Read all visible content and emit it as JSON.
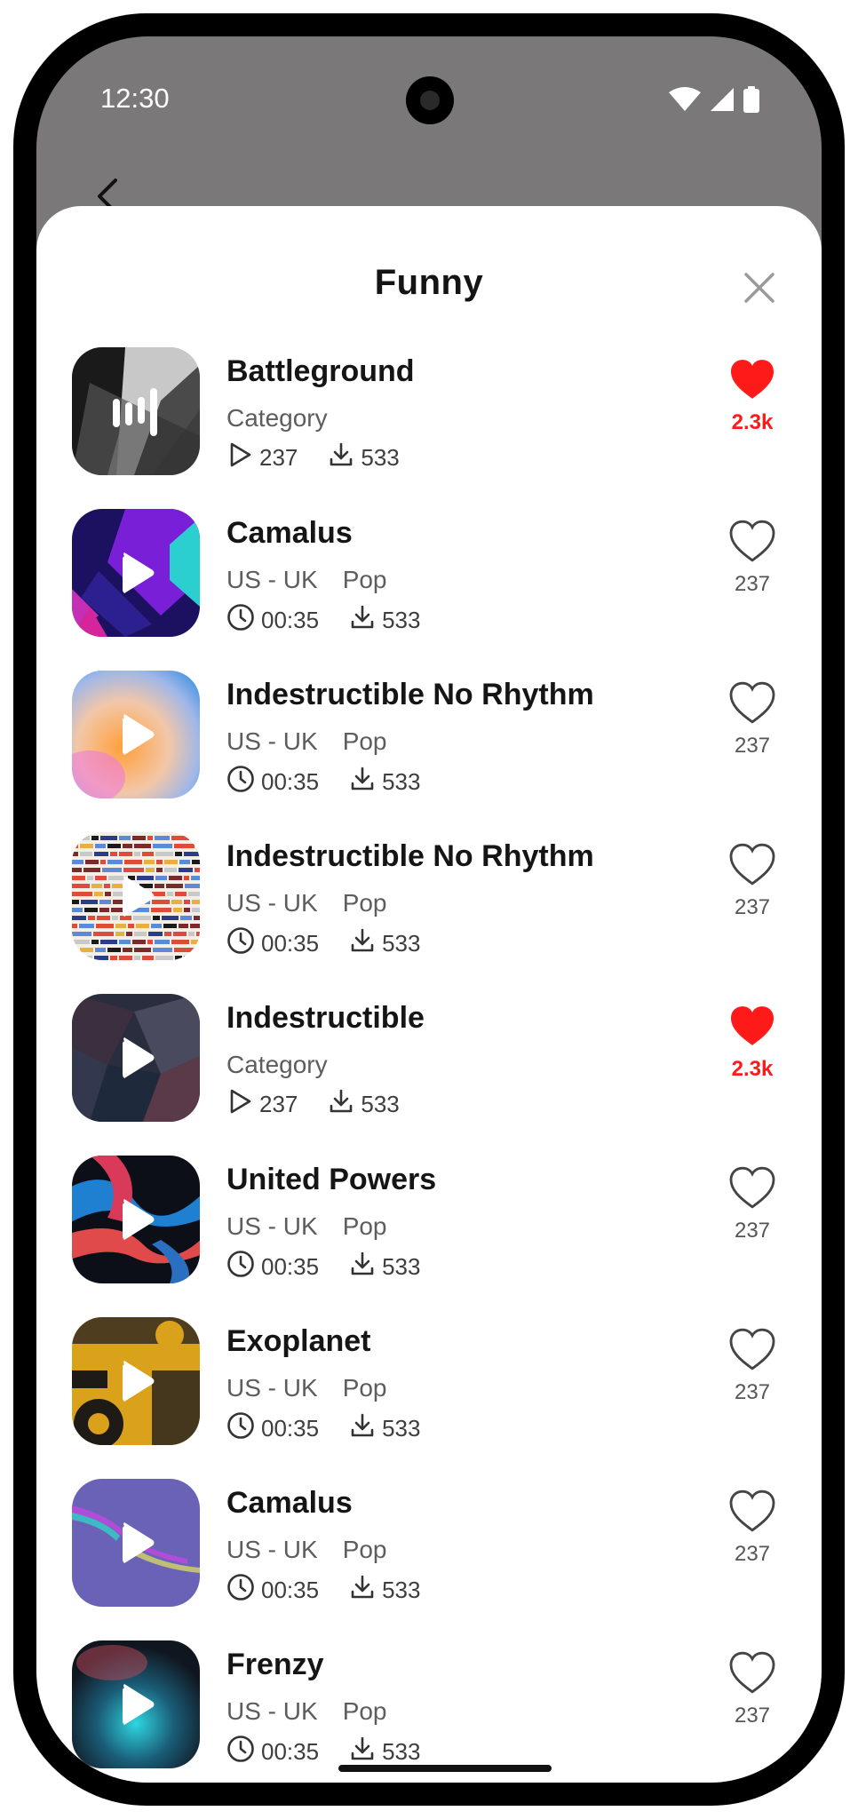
{
  "status": {
    "time": "12:30"
  },
  "sheet": {
    "title": "Funny"
  },
  "items": [
    {
      "title": "Battleground",
      "subtitle": "Category",
      "genre": "",
      "meta_a": "237",
      "meta_b": "533",
      "likes": "2.3k",
      "liked": true,
      "meta_icon": "play-outline-icon",
      "art": "grey-abstract"
    },
    {
      "title": "Camalus",
      "subtitle": "US - UK",
      "genre": "Pop",
      "meta_a": "00:35",
      "meta_b": "533",
      "likes": "237",
      "liked": false,
      "meta_icon": "clock-icon",
      "art": "purple-geometric"
    },
    {
      "title": "Indestructible No Rhythm",
      "subtitle": "US - UK",
      "genre": "Pop",
      "meta_a": "00:35",
      "meta_b": "533",
      "likes": "237",
      "liked": false,
      "meta_icon": "clock-icon",
      "art": "pastel-gradient"
    },
    {
      "title": "Indestructible No Rhythm",
      "subtitle": "US - UK",
      "genre": "Pop",
      "meta_a": "00:35",
      "meta_b": "533",
      "likes": "237",
      "liked": false,
      "meta_icon": "clock-icon",
      "art": "pixel-stripes"
    },
    {
      "title": "Indestructible",
      "subtitle": "Category",
      "genre": "",
      "meta_a": "237",
      "meta_b": "533",
      "likes": "2.3k",
      "liked": true,
      "meta_icon": "play-outline-icon",
      "art": "dark-polygons"
    },
    {
      "title": "United Powers",
      "subtitle": "US - UK",
      "genre": "Pop",
      "meta_a": "00:35",
      "meta_b": "533",
      "likes": "237",
      "liked": false,
      "meta_icon": "clock-icon",
      "art": "fluid-red-blue"
    },
    {
      "title": "Exoplanet",
      "subtitle": "US - UK",
      "genre": "Pop",
      "meta_a": "00:35",
      "meta_b": "533",
      "likes": "237",
      "liked": false,
      "meta_icon": "clock-icon",
      "art": "yellow-grunge"
    },
    {
      "title": "Camalus",
      "subtitle": "US - UK",
      "genre": "Pop",
      "meta_a": "00:35",
      "meta_b": "533",
      "likes": "237",
      "liked": false,
      "meta_icon": "clock-icon",
      "art": "violet-wave"
    },
    {
      "title": "Frenzy",
      "subtitle": "US - UK",
      "genre": "Pop",
      "meta_a": "00:35",
      "meta_b": "533",
      "likes": "237",
      "liked": false,
      "meta_icon": "clock-icon",
      "art": "teal-glow"
    }
  ],
  "colors": {
    "liked": "#ff1a1a",
    "text": "#151515",
    "muted": "#5d5d5d",
    "frame": "#000000",
    "scrim": "#7b7879"
  }
}
